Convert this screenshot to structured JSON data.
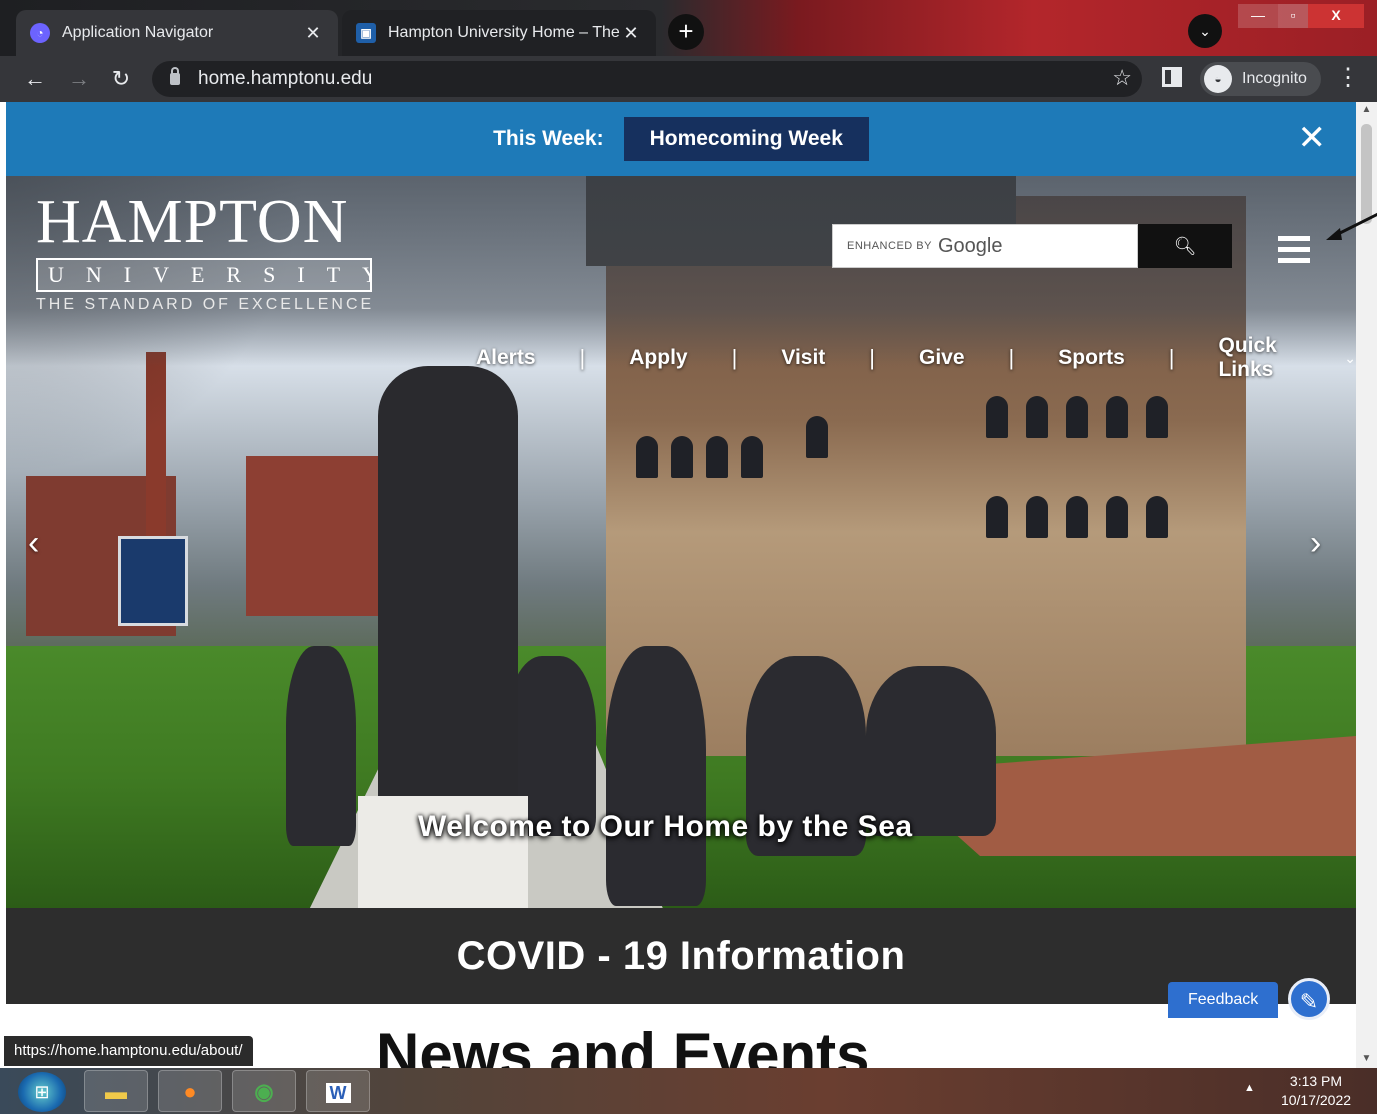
{
  "browser": {
    "tabs": [
      {
        "title": "Application Navigator",
        "icon": "app-navigator-icon",
        "active": true
      },
      {
        "title": "Hampton University Home – The",
        "icon": "hampton-favicon-icon",
        "active": false
      }
    ],
    "url": "home.hamptonu.edu",
    "incognito_label": "Incognito",
    "status_url": "https://home.hamptonu.edu/about/"
  },
  "announcement": {
    "label": "This Week:",
    "highlight": "Homecoming Week",
    "colors": {
      "bar": "#1e7ab8",
      "pill": "#16305e"
    }
  },
  "header": {
    "logo_main": "HAMPTON",
    "logo_sub": "UNIVERSITY",
    "tagline": "THE STANDARD OF EXCELLENCE",
    "search_enhanced": "ENHANCED BY",
    "search_brand": "Google"
  },
  "nav": {
    "items": [
      "Alerts",
      "Apply",
      "Visit",
      "Give",
      "Sports",
      "Quick Links"
    ],
    "separator": "|"
  },
  "hero": {
    "caption": "Welcome to Our Home by the Sea"
  },
  "covid": {
    "title": "COVID - 19 Information"
  },
  "news": {
    "title": "News and Events"
  },
  "feedback": {
    "label": "Feedback"
  },
  "taskbar": {
    "time": "3:13 PM",
    "date": "10/17/2022",
    "word_letter": "W"
  }
}
